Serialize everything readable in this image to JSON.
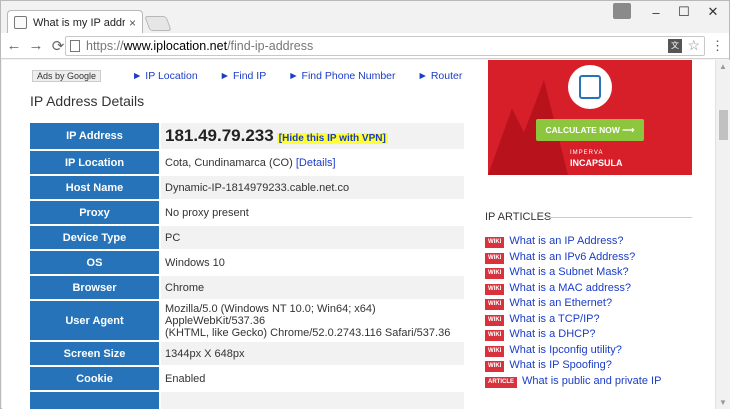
{
  "browser": {
    "tab_title": "What is my IP address?",
    "tab_close": "×",
    "window_controls": {
      "minimize": "–",
      "maximize": "☐",
      "close": "✕"
    },
    "nav": {
      "back": "←",
      "forward": "→",
      "reload": "⟳"
    },
    "url": {
      "protocol": "https://",
      "host": "www.iplocation.net",
      "path": "/find-ip-address"
    },
    "translate_glyph": "文",
    "star_glyph": "☆",
    "menu_glyph": "⋮"
  },
  "page": {
    "ads_by": "Ads by Google",
    "top_links": [
      "► IP Location",
      "► Find IP",
      "► Find Phone Number",
      "► Router"
    ],
    "heading": "IP Address Details",
    "details": {
      "ip_address": {
        "label": "IP Address",
        "value": "181.49.79.233",
        "hide_link": "[Hide this IP with VPN]"
      },
      "ip_location": {
        "label": "IP Location",
        "value": "Cota, Cundinamarca (CO)",
        "details_link": "[Details]"
      },
      "host_name": {
        "label": "Host Name",
        "value": "Dynamic-IP-1814979233.cable.net.co"
      },
      "proxy": {
        "label": "Proxy",
        "value": "No proxy present"
      },
      "device_type": {
        "label": "Device Type",
        "value": "PC"
      },
      "os": {
        "label": "OS",
        "value": "Windows 10"
      },
      "browser": {
        "label": "Browser",
        "value": "Chrome"
      },
      "user_agent": {
        "label": "User Agent",
        "value_line1": "Mozilla/5.0 (Windows NT 10.0; Win64; x64) AppleWebKit/537.36",
        "value_line2": "(KHTML, like Gecko) Chrome/52.0.2743.116 Safari/537.36"
      },
      "screen_size": {
        "label": "Screen Size",
        "value": "1344px X 648px"
      },
      "cookie": {
        "label": "Cookie",
        "value": "Enabled"
      }
    },
    "ad": {
      "cta": "CALCULATE NOW ⟶",
      "brand_top": "IMPERVA",
      "brand_bottom": "INCAPSULA"
    },
    "articles_heading": "IP ARTICLES",
    "articles": [
      {
        "badge": "WIKI",
        "title": "What is an IP Address?"
      },
      {
        "badge": "WIKI",
        "title": "What is an IPv6 Address?"
      },
      {
        "badge": "WIKI",
        "title": "What is a Subnet Mask?"
      },
      {
        "badge": "WIKI",
        "title": "What is a MAC address?"
      },
      {
        "badge": "WIKI",
        "title": "What is an Ethernet?"
      },
      {
        "badge": "WIKI",
        "title": "What is a TCP/IP?"
      },
      {
        "badge": "WIKI",
        "title": "What is a DHCP?"
      },
      {
        "badge": "WIKI",
        "title": "What is Ipconfig utility?"
      },
      {
        "badge": "WIKI",
        "title": "What is IP Spoofing?"
      },
      {
        "badge": "ARTICLE",
        "title": "What is public and private IP"
      }
    ]
  }
}
